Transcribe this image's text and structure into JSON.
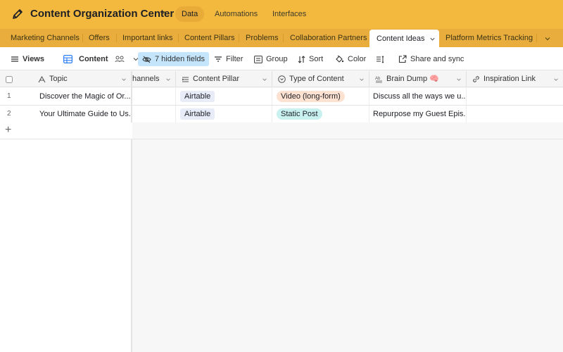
{
  "app": {
    "title": "Content Organization Center",
    "top_tabs": [
      {
        "label": "Data",
        "active": true
      },
      {
        "label": "Automations",
        "active": false
      },
      {
        "label": "Interfaces",
        "active": false
      }
    ]
  },
  "tables": [
    {
      "label": "Marketing Channels"
    },
    {
      "label": "Offers"
    },
    {
      "label": "Important links"
    },
    {
      "label": "Content Pillars"
    },
    {
      "label": "Problems"
    },
    {
      "label": "Collaboration Partners"
    },
    {
      "label": "Content Ideas",
      "active": true
    },
    {
      "label": "Platform Metrics Tracking"
    }
  ],
  "toolbar": {
    "views_label": "Views",
    "view_name": "Content",
    "hidden_fields_label": "7 hidden fields",
    "filter_label": "Filter",
    "group_label": "Group",
    "sort_label": "Sort",
    "color_label": "Color",
    "share_label": "Share and sync"
  },
  "grid": {
    "columns": {
      "topic": "Topic",
      "channels": "hannels",
      "content_pillar": "Content Pillar",
      "type_of_content": "Type of Content",
      "brain_dump": "Brain Dump 🧠",
      "inspiration_link": "Inspiration Link"
    },
    "rows": [
      {
        "num": "1",
        "topic": "Discover the Magic of Or...",
        "content_pillar": "Airtable",
        "type_of_content": "Video (long-form)",
        "type_color": "#fde2d1",
        "brain_dump": "Discuss all the ways we u...",
        "inspiration_link": ""
      },
      {
        "num": "2",
        "topic": "Your Ultimate Guide to Us...",
        "content_pillar": "Airtable",
        "type_of_content": "Static Post",
        "type_color": "#c9f1f0",
        "brain_dump": "Repurpose my Guest Epis...",
        "inspiration_link": ""
      }
    ],
    "add_row_symbol": "+"
  },
  "colors": {
    "header_bg": "#f3b93e",
    "tablebar_bg": "#e8ad3c",
    "hidden_fields_bg": "#c4e5fb",
    "pillar_pill_bg": "#e8ecf8"
  }
}
